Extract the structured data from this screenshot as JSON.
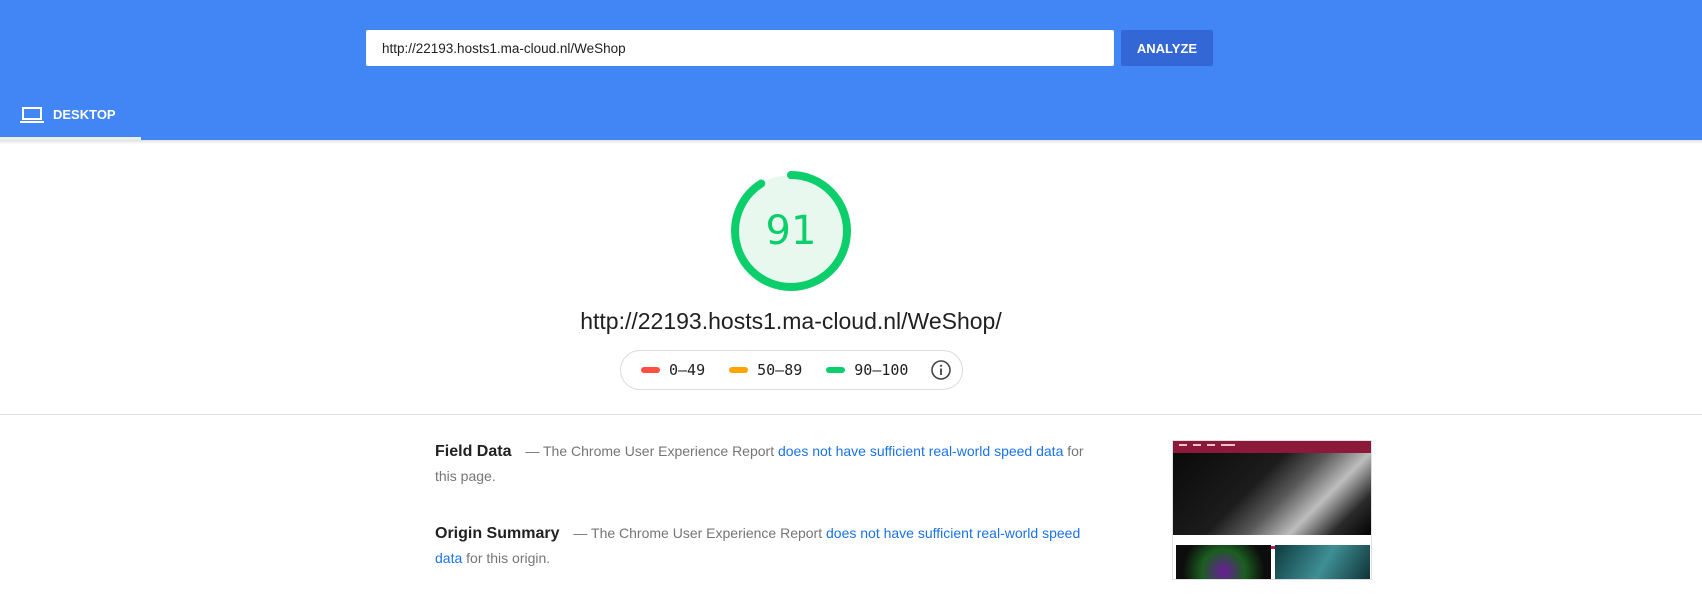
{
  "header": {
    "url_value": "http://22193.hosts1.ma-cloud.nl/WeShop",
    "analyze_label": "ANALYZE",
    "tabs": [
      {
        "label": "DESKTOP",
        "icon": "laptop-icon",
        "selected": true
      }
    ]
  },
  "score": {
    "value": "91",
    "fraction": 0.91,
    "color": "#0cce6b"
  },
  "page_url": "http://22193.hosts1.ma-cloud.nl/WeShop/",
  "legend": {
    "items": [
      {
        "label": "0–49",
        "color": "#ff4e42"
      },
      {
        "label": "50–89",
        "color": "#ffa400"
      },
      {
        "label": "90–100",
        "color": "#0cce6b"
      }
    ],
    "info_icon": "info-icon"
  },
  "field_data": {
    "title": "Field Data",
    "prefix": "— The Chrome User Experience Report",
    "link": "does not have sufficient real-world speed data",
    "suffix": "for this page."
  },
  "origin_summary": {
    "title": "Origin Summary",
    "prefix": "— The Chrome User Experience Report",
    "link": "does not have sufficient real-world speed data",
    "suffix": "for this origin."
  },
  "colors": {
    "header_bg": "#4285f4",
    "button_bg": "#3367d6",
    "link": "#1a73e8",
    "pass": "#0cce6b"
  }
}
